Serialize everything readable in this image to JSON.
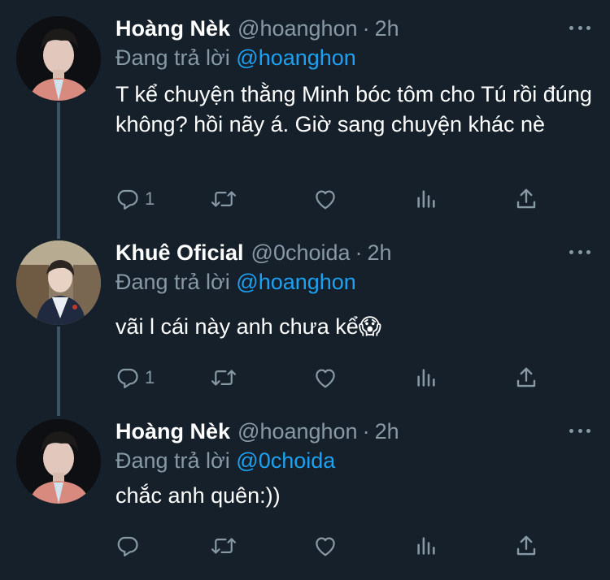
{
  "tweets": [
    {
      "name": "Hoàng Nèk",
      "handle": "@hoanghon",
      "separator": "·",
      "time": "2h",
      "replying_prefix": "Đang trả lời",
      "replying_to": "@hoanghon",
      "text": "T kể chuyện thằng Minh bóc tôm cho Tú rồi đúng không? hồi nãy á. Giờ sang chuyện khác nè",
      "reply_count": "1"
    },
    {
      "name": "Khuê Oficial",
      "handle": "@0choida",
      "separator": "·",
      "time": "2h",
      "replying_prefix": "Đang trả lời",
      "replying_to": "@hoanghon",
      "text": "vãi l cái này anh chưa kể😱",
      "reply_count": "1"
    },
    {
      "name": "Hoàng Nèk",
      "handle": "@hoanghon",
      "separator": "·",
      "time": "2h",
      "replying_prefix": "Đang trả lời",
      "replying_to": "@0choida",
      "text": "chắc anh quên:))",
      "reply_count": ""
    }
  ],
  "icons": {
    "reply": "reply-icon",
    "retweet": "retweet-icon",
    "like": "heart-icon",
    "analytics": "analytics-icon",
    "share": "share-icon",
    "more": "more-icon"
  },
  "colors": {
    "background": "#15202b",
    "text": "#ffffff",
    "secondary": "#8899a6",
    "accent": "#1da1f2",
    "thread_line": "#3d5466"
  }
}
